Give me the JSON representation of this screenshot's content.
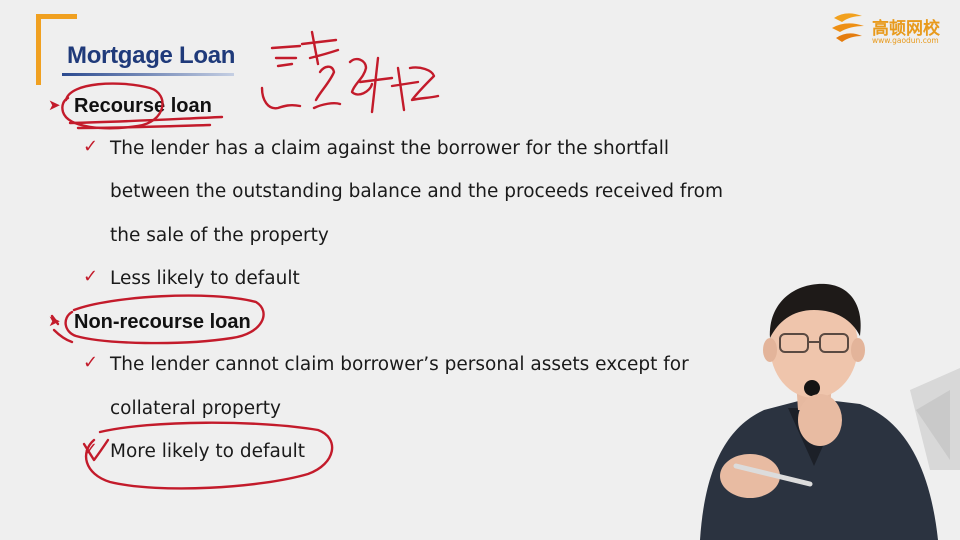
{
  "slide": {
    "title": "Mortgage Loan",
    "sections": [
      {
        "heading": "Recourse loan",
        "bullets": [
          [
            "The lender has a claim against the borrower for the shortfall",
            "between the outstanding balance and the proceeds received from",
            "the sale of the property"
          ],
          [
            "Less likely to default"
          ]
        ]
      },
      {
        "heading": "Non-recourse loan",
        "bullets": [
          [
            "The lender cannot claim borrower’s personal assets except for",
            "collateral property"
          ],
          [
            "More likely to default"
          ]
        ]
      }
    ]
  },
  "logo": {
    "name": "高顿网校",
    "url": "www.gaodun.com"
  },
  "glyphs": {
    "pointer": "➤",
    "check": "✓"
  },
  "colors": {
    "title": "#1f3a7a",
    "bracket": "#f0a020",
    "logo": "#e89a1c",
    "annotation": "#c31b2b",
    "background": "#efefef"
  }
}
